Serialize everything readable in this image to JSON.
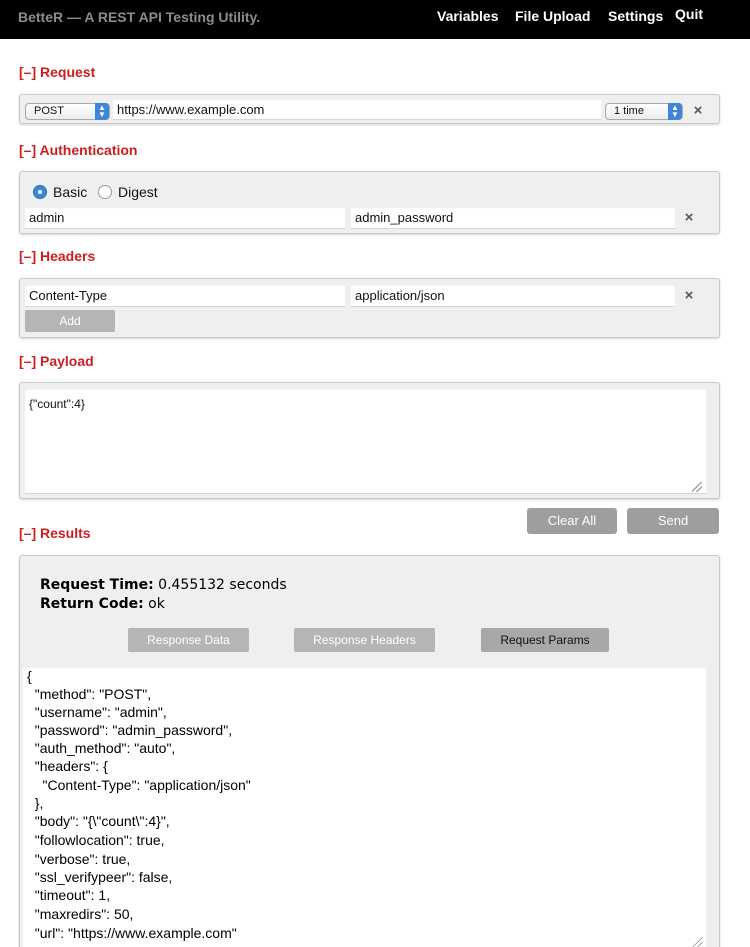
{
  "app": {
    "title": "BetteR — A REST API Testing Utility.",
    "nav": [
      "Variables",
      "File Upload",
      "Settings",
      "Quit"
    ]
  },
  "request": {
    "header": "[–] Request",
    "method": "POST",
    "url": "https://www.example.com",
    "repeat": "1 time"
  },
  "authentication": {
    "header": "[–] Authentication",
    "options": [
      "Basic",
      "Digest"
    ],
    "selected": "Basic",
    "username": "admin",
    "password": "admin_password"
  },
  "headers": {
    "header": "[–] Headers",
    "rows": [
      {
        "name": "Content-Type",
        "value": "application/json"
      }
    ],
    "add_label": "Add"
  },
  "payload": {
    "header": "[–] Payload",
    "body": "{\"count\":4}"
  },
  "actions": {
    "clear_label": "Clear All",
    "send_label": "Send"
  },
  "results": {
    "header": "[–] Results",
    "request_time_label": "Request Time:",
    "request_time_value": "0.455132 seconds",
    "return_code_label": "Return Code:",
    "return_code_value": "ok",
    "tabs": [
      "Response Data",
      "Response Headers",
      "Request Params"
    ],
    "active_tab": "Request Params",
    "lines": [
      "{",
      "  \"method\": \"POST\",",
      "  \"username\": \"admin\",",
      "  \"password\": \"admin_password\",",
      "  \"auth_method\": \"auto\",",
      "  \"headers\": {",
      "    \"Content-Type\": \"application/json\"",
      "  },",
      "  \"body\": \"{\\\"count\\\":4}\",",
      "  \"followlocation\": true,",
      "  \"verbose\": true,",
      "  \"ssl_verifypeer\": false,",
      "  \"timeout\": 1,",
      "  \"maxredirs\": 50,",
      "  \"url\": \"https://www.example.com\""
    ]
  },
  "colors": {
    "topbar": "#000000",
    "section_header": "#cc1e1e",
    "radio_accent": "#3d86d8",
    "button_gray": "#b5b5b5"
  }
}
